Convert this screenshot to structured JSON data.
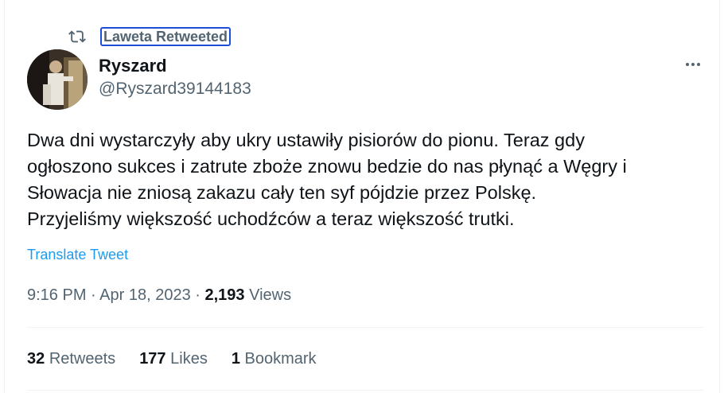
{
  "retweet": {
    "label": "Laweta Retweeted"
  },
  "author": {
    "name": "Ryszard",
    "handle": "@Ryszard39144183"
  },
  "tweet": {
    "lines": [
      "Dwa dni wystarczyły aby ukry ustawiły pisiorów do pionu. Teraz gdy",
      "ogłoszono sukces i zatrute zboże znowu bedzie do nas płynąć a Węgry i",
      "Słowacja nie zniosą zakazu cały ten syf pójdzie przez Polskę.",
      "Przyjeliśmy większość uchodźców a teraz większość trutki."
    ],
    "translate_label": "Translate Tweet"
  },
  "meta": {
    "time": "9:16 PM",
    "sep1": "·",
    "date": "Apr 18, 2023",
    "sep2": "·",
    "views_count": "2,193",
    "views_label": "Views"
  },
  "stats": {
    "retweets_count": "32",
    "retweets_label": "Retweets",
    "likes_count": "177",
    "likes_label": "Likes",
    "bookmarks_count": "1",
    "bookmarks_label": "Bookmark"
  },
  "colors": {
    "link": "#1d9bf0",
    "secondary": "#536471",
    "primary": "#0f1419"
  },
  "icons": {
    "retweet": "retweet-icon",
    "more": "more-icon"
  }
}
